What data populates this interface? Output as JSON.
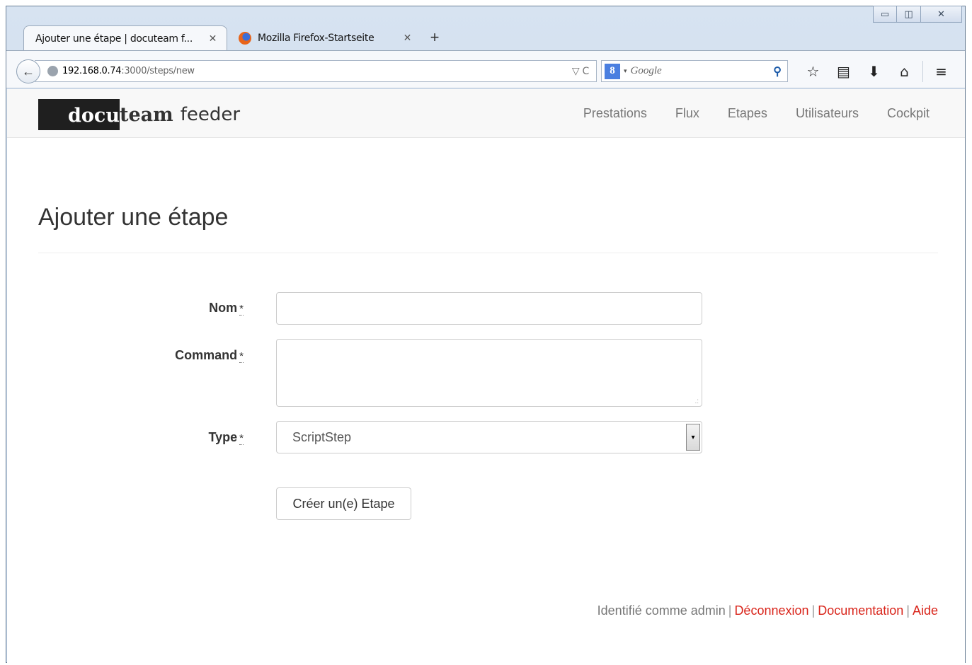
{
  "browser": {
    "tabs": [
      {
        "title": "Ajouter une étape | docuteam f...",
        "close": "✕"
      },
      {
        "title": "Mozilla Firefox-Startseite",
        "close": "✕"
      }
    ],
    "new_tab": "+",
    "back": "←",
    "url_host": "192.168.0.74",
    "url_path": ":3000/steps/new",
    "url_controls": "▽ C",
    "search_engine": "8",
    "search_caret": "▾",
    "search_placeholder": "Google",
    "search_icon": "⚲",
    "window_controls": [
      "▭",
      "◫",
      "✕"
    ],
    "toolbar_icons": [
      "☆",
      "▤",
      "⬇",
      "⌂",
      "≡"
    ]
  },
  "site": {
    "logo": {
      "docu": "docu",
      "team": "team",
      "feeder": "feeder"
    },
    "nav": [
      "Prestations",
      "Flux",
      "Etapes",
      "Utilisateurs",
      "Cockpit"
    ]
  },
  "page": {
    "title": "Ajouter une étape",
    "fields": {
      "name_label": "Nom",
      "command_label": "Command",
      "type_label": "Type",
      "required_mark": "*",
      "type_value": "ScriptStep",
      "select_arrow": "▾",
      "resize_grip": ".:"
    },
    "submit_label": "Créer un(e) Etape"
  },
  "footer": {
    "logged_in_text": "Identifié comme admin",
    "separator": "|",
    "logout": "Déconnexion",
    "documentation": "Documentation",
    "help": "Aide"
  }
}
